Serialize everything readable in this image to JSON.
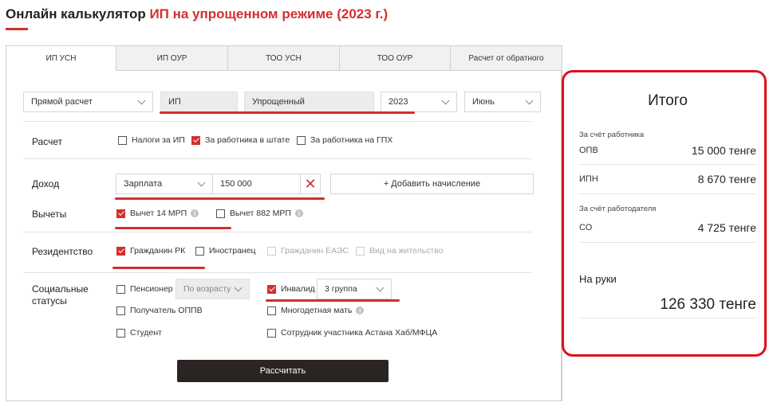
{
  "title": {
    "prefix": "Онлайн калькулятор ",
    "accent": "ИП на упрощенном режиме (2023 г.)"
  },
  "tabs": [
    "ИП УСН",
    "ИП ОУР",
    "ТОО УСН",
    "ТОО ОУР",
    "Расчет от обратного"
  ],
  "filters": {
    "mode": "Прямой расчет",
    "entity": "ИП",
    "regime": "Упрощенный",
    "year": "2023",
    "month": "Июнь"
  },
  "sections": {
    "calc": {
      "label": "Расчет",
      "options": [
        {
          "label": "Налоги за ИП",
          "checked": false
        },
        {
          "label": "За работника в штате",
          "checked": true
        },
        {
          "label": "За работника на ГПХ",
          "checked": false
        }
      ]
    },
    "income": {
      "label": "Доход",
      "type": "Зарплата",
      "amount": "150 000",
      "remove_icon": "✕",
      "add_label": "+ Добавить начисление"
    },
    "deductions": {
      "label": "Вычеты",
      "options": [
        {
          "label": "Вычет 14 МРП",
          "checked": true
        },
        {
          "label": "Вычет 882 МРП",
          "checked": false
        }
      ]
    },
    "residency": {
      "label": "Резидентство",
      "options": [
        {
          "label": "Гражданин РК",
          "checked": true
        },
        {
          "label": "Иностранец",
          "checked": false
        },
        {
          "label": "Гражданин ЕАЭС",
          "checked": false
        },
        {
          "label": "Вид на жительство",
          "checked": false
        }
      ]
    },
    "social": {
      "label_line1": "Социальные",
      "label_line2": "статусы",
      "pensioner": "Пенсионер",
      "pensioner_select": "По возрасту",
      "disabled": "Инвалид",
      "disabled_group": "3 группа",
      "oppv": "Получатель ОППВ",
      "mother": "Многодетная мать",
      "student": "Студент",
      "astana": "Сотрудник участника Астана Хаб/МФЦА"
    }
  },
  "calculate_label": "Рассчитать",
  "result": {
    "title": "Итого",
    "employee_header": "За счёт работника",
    "opv_label": "ОПВ",
    "opv_value": "15 000 тенге",
    "ipn_label": "ИПН",
    "ipn_value": "8 670 тенге",
    "employer_header": "За счёт работодателя",
    "so_label": "СО",
    "so_value": "4 725 тенге",
    "on_hand_label": "На руки",
    "on_hand_value": "126 330 тенге"
  },
  "info_icon": "i",
  "colors": {
    "accent": "#d32f2f",
    "highlight": "#e0101a",
    "button": "#2a2522"
  }
}
